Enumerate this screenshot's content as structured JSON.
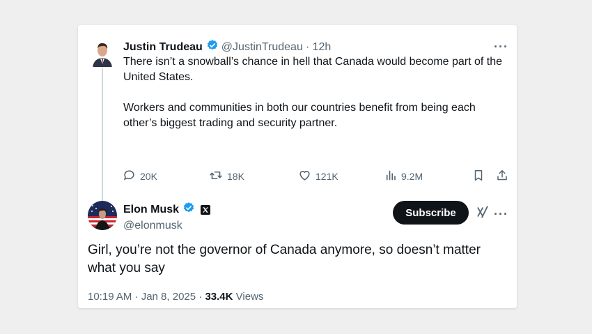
{
  "tweet1": {
    "name": "Justin Trudeau",
    "handle": "@JustinTrudeau",
    "time": "· 12h",
    "paragraph1": "There isn’t a snowball’s chance in hell that Canada would become part of the United States.",
    "paragraph2": "Workers and communities in both our countries benefit from being each other’s biggest trading and security partner.",
    "replies": "20K",
    "reposts": "18K",
    "likes": "121K",
    "views": "9.2M",
    "more": "···"
  },
  "tweet2": {
    "name": "Elon Musk",
    "handle": "@elonmusk",
    "subscribe_label": "Subscribe",
    "more": "···",
    "text": "Girl, you’re not the governor of Canada anymore, so doesn’t matter what you say",
    "time_date": "10:19 AM · Jan 8, 2025 ·",
    "views_count": "33.4K",
    "views_label": "Views"
  },
  "colors": {
    "verified": "#1d9bf0",
    "muted": "#536471",
    "text": "#0f1419",
    "background": "#efefef"
  },
  "icons": [
    "reply-icon",
    "repost-icon",
    "like-icon",
    "views-icon",
    "bookmark-icon",
    "share-icon",
    "verified-badge-icon",
    "x-logo-icon",
    "grok-icon",
    "more-icon"
  ]
}
